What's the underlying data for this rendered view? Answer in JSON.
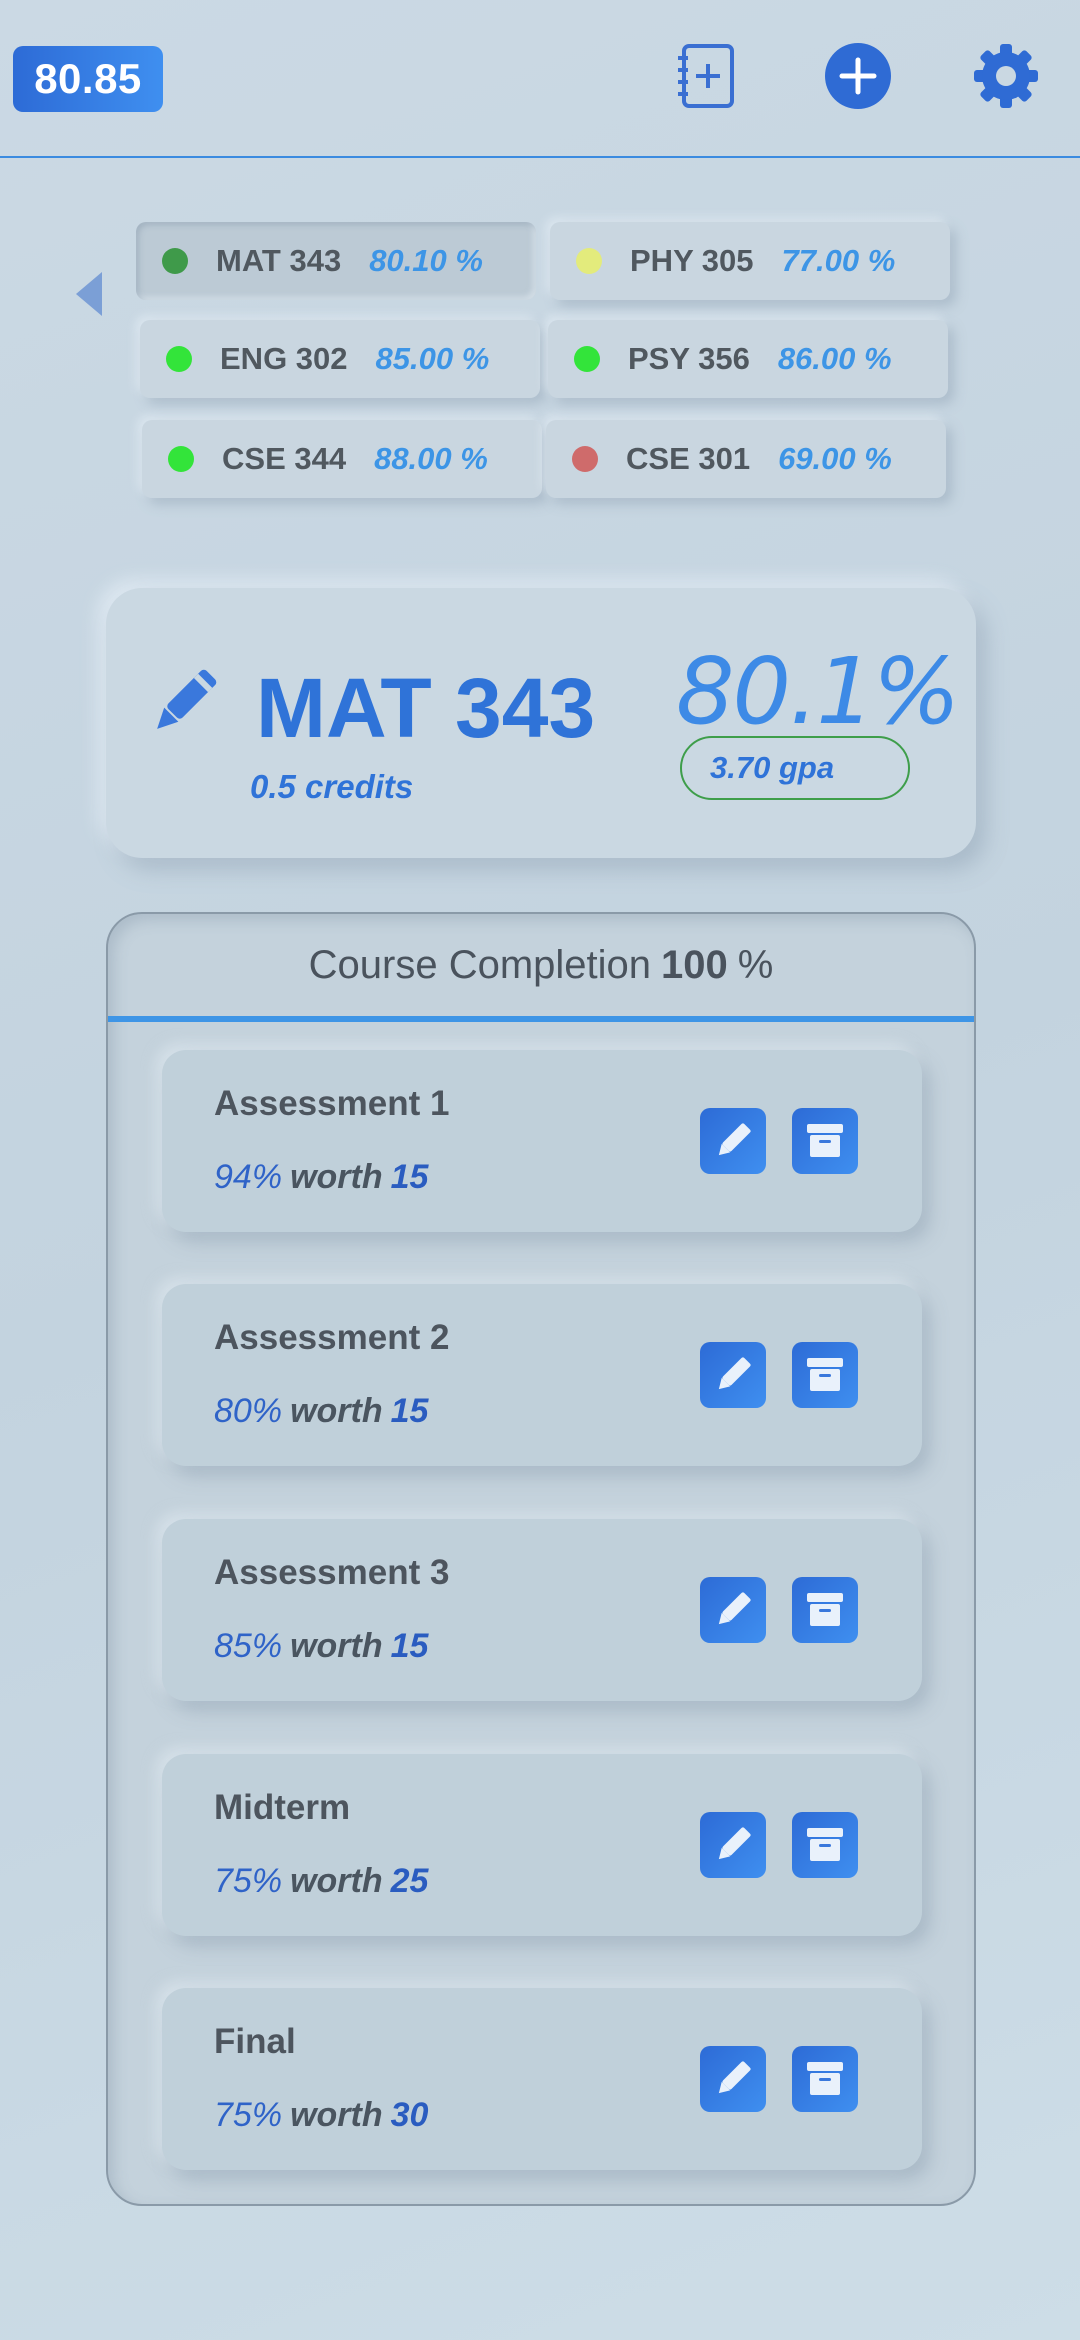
{
  "header": {
    "overall_average": "80.85"
  },
  "courses": [
    {
      "code": "MAT 343",
      "percent": "80.10 %",
      "status_color": "#3f9a4a",
      "active": true
    },
    {
      "code": "PHY 305",
      "percent": "77.00 %",
      "status_color": "#e3eb7c",
      "active": false
    },
    {
      "code": "ENG 302",
      "percent": "85.00 %",
      "status_color": "#33e43a",
      "active": false
    },
    {
      "code": "PSY 356",
      "percent": "86.00 %",
      "status_color": "#33e43a",
      "active": false
    },
    {
      "code": "CSE 344",
      "percent": "88.00 %",
      "status_color": "#33e43a",
      "active": false
    },
    {
      "code": "CSE 301",
      "percent": "69.00 %",
      "status_color": "#cf6b6b",
      "active": false
    }
  ],
  "selected_course": {
    "code": "MAT 343",
    "credits": "0.5 credits",
    "grade": "80.1%",
    "gpa": "3.70 gpa"
  },
  "completion": {
    "label": "Course Completion",
    "value": "100",
    "unit": "%"
  },
  "assessments": [
    {
      "name": "Assessment 1",
      "score": "94%",
      "worth_label": "worth",
      "weight": "15"
    },
    {
      "name": "Assessment 2",
      "score": "80%",
      "worth_label": "worth",
      "weight": "15"
    },
    {
      "name": "Assessment 3",
      "score": "85%",
      "worth_label": "worth",
      "weight": "15"
    },
    {
      "name": "Midterm",
      "score": "75%",
      "worth_label": "worth",
      "weight": "25"
    },
    {
      "name": "Final",
      "score": "75%",
      "worth_label": "worth",
      "weight": "30"
    }
  ],
  "icons": {
    "notebook": "notebook-add-icon",
    "add": "plus-circle-icon",
    "settings": "gear-icon",
    "back": "caret-left-icon",
    "edit": "pencil-icon",
    "archive": "archive-icon"
  },
  "colors": {
    "accent": "#2f73d8",
    "accent_light": "#3d95e6",
    "background": "#c9d7e2"
  }
}
